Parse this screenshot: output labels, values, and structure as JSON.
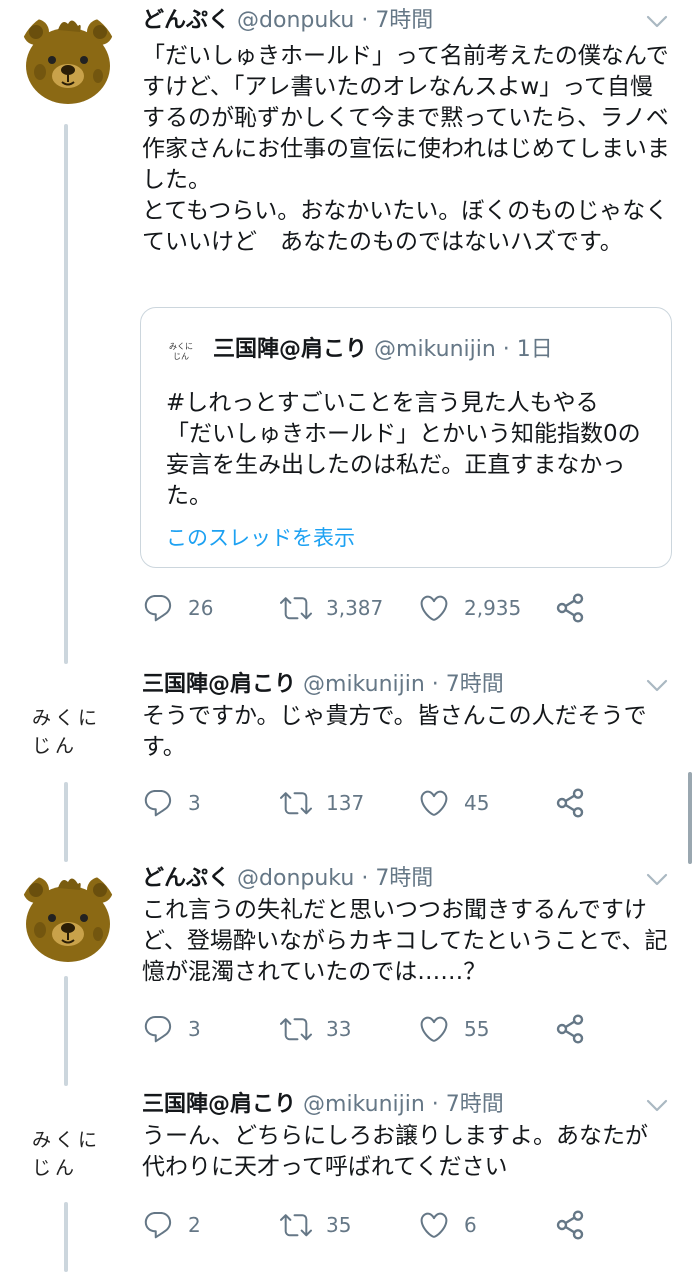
{
  "tweets": [
    {
      "name": "どんぷく",
      "handle": "@donpuku",
      "separator": "·",
      "time": "7時間",
      "text": "「だいしゅきホールド」って名前考えたの僕なんですけど、「アレ書いたのオレなんスよw」って自慢するのが恥ずかしくて今まで黙っていたら、ラノベ作家さんにお仕事の宣伝に使われはじめてしまいました。\nとてもつらい。おなかいたい。ぼくのものじゃなくていいけど　あなたのものではないハズです。",
      "replies": "26",
      "retweets": "3,387",
      "likes": "2,935"
    },
    {
      "name": "三国陣@肩こり",
      "handle": "@mikunijin",
      "separator": "·",
      "time": "7時間",
      "avatar_text": "みくにじん",
      "text": "そうですか。じゃ貴方で。皆さんこの人だそうです。",
      "replies": "3",
      "retweets": "137",
      "likes": "45"
    },
    {
      "name": "どんぷく",
      "handle": "@donpuku",
      "separator": "·",
      "time": "7時間",
      "text": "これ言うの失礼だと思いつつお聞きするんですけど、登場酔いながらカキコしてたということで、記憶が混濁されていたのでは……？",
      "replies": "3",
      "retweets": "33",
      "likes": "55"
    },
    {
      "name": "三国陣@肩こり",
      "handle": "@mikunijin",
      "separator": "·",
      "time": "7時間",
      "avatar_text": "みくにじん",
      "text": "うーん、どちらにしろお譲りしますよ。あなたが代わりに天才って呼ばれてください",
      "replies": "2",
      "retweets": "35",
      "likes": "6"
    }
  ],
  "quote": {
    "name": "三国陣@肩こり",
    "handle": "@mikunijin",
    "separator": "·",
    "time": "1日",
    "avatar_text": "みくにじん",
    "text": "#しれっとすごいことを言う見た人もやる\n「だいしゅきホールド」とかいう知能指数0の妄言を生み出したのは私だ。正直すまなかった。",
    "link": "このスレッドを表示"
  },
  "colors": {
    "link": "#1da1f2",
    "muted": "#657786",
    "thread_line": "#ccd6dd",
    "bear_fur": "#8b6914"
  },
  "icons": [
    "reply-icon",
    "retweet-icon",
    "like-icon",
    "share-icon",
    "chevron-down-icon",
    "bear-avatar"
  ]
}
